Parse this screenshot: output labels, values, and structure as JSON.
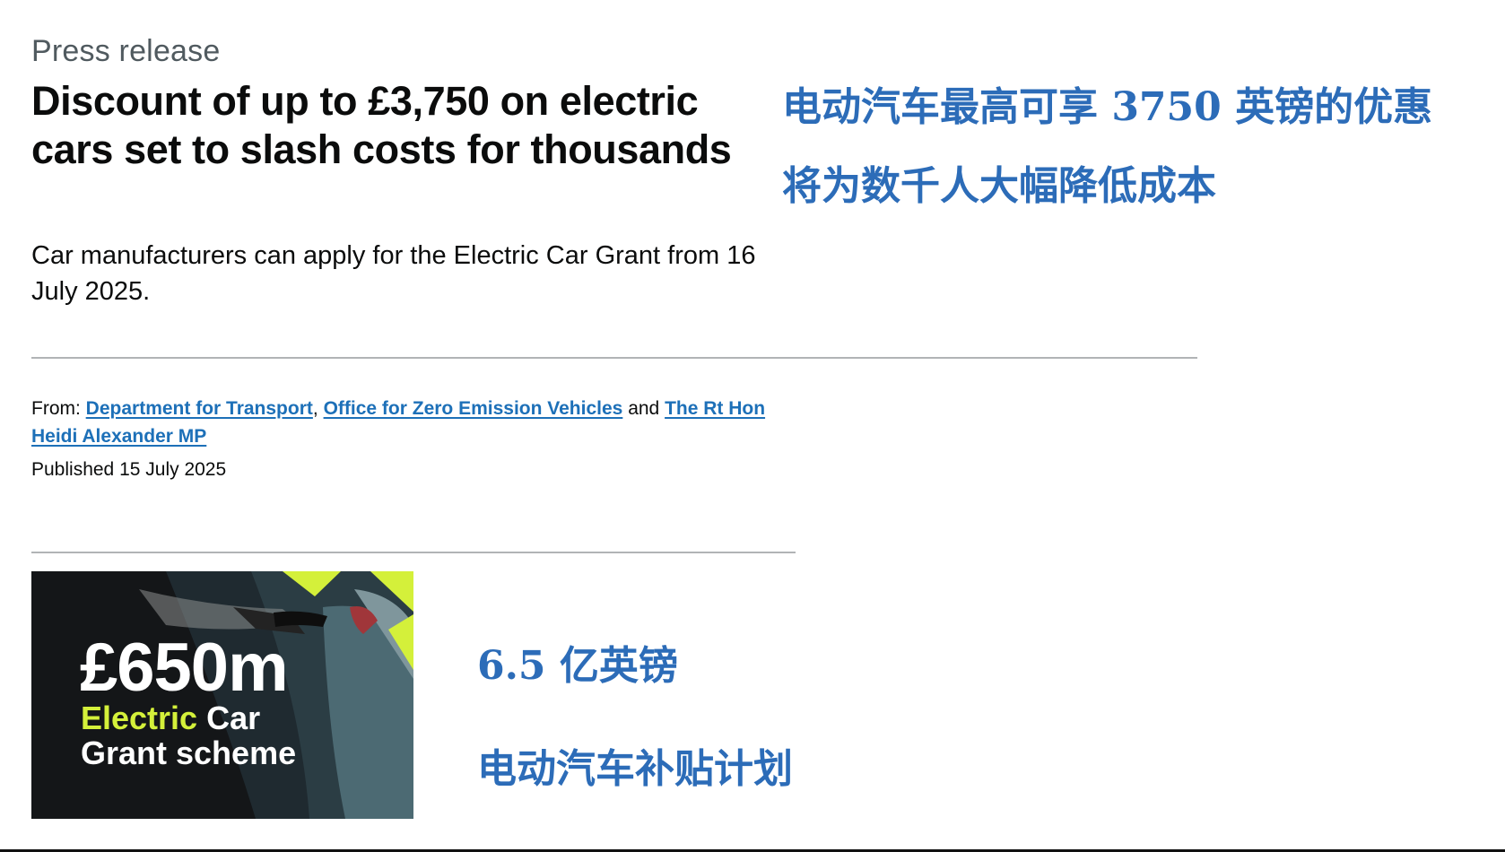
{
  "page": {
    "kind": "Press release",
    "title": "Discount of up to £3,750 on electric cars set to slash costs for thousands",
    "lead": "Car manufacturers can apply for the Electric Car Grant from 16 July 2025.",
    "from_label": "From:",
    "orgs": [
      {
        "label": "Department for Transport"
      },
      {
        "label": "Office for Zero Emission Vehicles"
      },
      {
        "label": "The Rt Hon Heidi Alexander MP"
      }
    ],
    "sep_comma": ",",
    "sep_and": "and",
    "published": "Published 15 July 2025"
  },
  "promo": {
    "amount": "£650m",
    "line1_accent": "Electric",
    "line1_rest": "Car",
    "line2": "Grant scheme",
    "accent_color": "#d4f03a"
  },
  "translation": {
    "title_line1": "电动汽车最高可享 3750 英镑的优惠",
    "title_line2": "将为数千人大幅降低成本",
    "amount": "6.5 亿英镑",
    "scheme": "电动汽车补贴计划",
    "color": "#2c6cb8"
  },
  "colors": {
    "link": "#1d70b8",
    "text": "#0b0c0c",
    "secondary": "#505a5f",
    "rule": "#b1b4b6"
  }
}
